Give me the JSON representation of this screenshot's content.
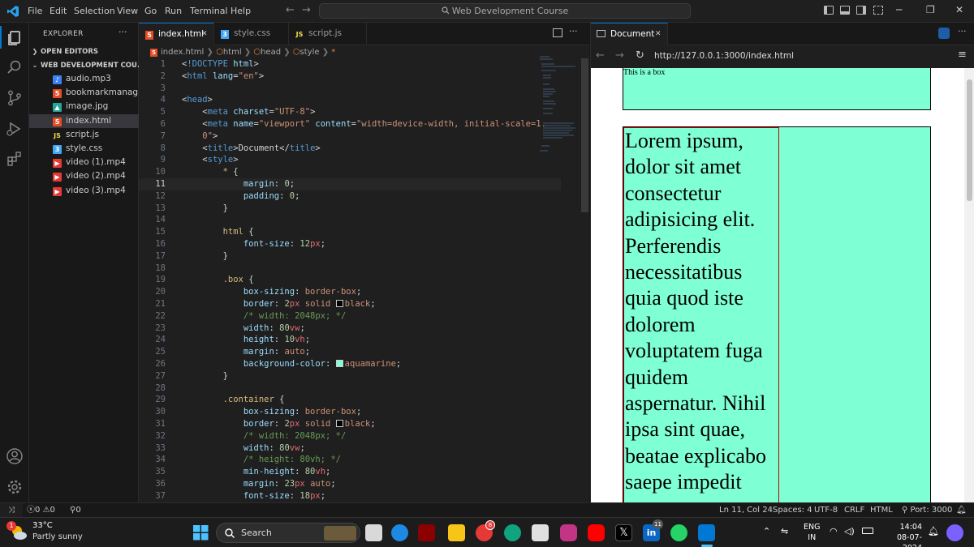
{
  "titlebar": {
    "menu": [
      "File",
      "Edit",
      "Selection",
      "View",
      "Go",
      "Run",
      "Terminal",
      "Help"
    ],
    "command_center": "Web Development Course",
    "nav_back": "←",
    "nav_forward": "→"
  },
  "sidebar": {
    "title": "EXPLORER",
    "more": "···",
    "open_editors": "OPEN EDITORS",
    "project": "WEB DEVELOPMENT COU...",
    "files": [
      {
        "name": "audio.mp3",
        "icon": "audio-file-icon",
        "color": "#3b82f6"
      },
      {
        "name": "bookmarkmanag...",
        "icon": "html-file-icon",
        "color": "#e44d26"
      },
      {
        "name": "image.jpg",
        "icon": "image-file-icon",
        "color": "#26a69a"
      },
      {
        "name": "index.html",
        "icon": "html-file-icon",
        "color": "#e44d26"
      },
      {
        "name": "script.js",
        "icon": "js-file-icon",
        "color": "#f0db4f"
      },
      {
        "name": "style.css",
        "icon": "css-file-icon",
        "color": "#42a5f5"
      },
      {
        "name": "video (1).mp4",
        "icon": "video-file-icon",
        "color": "#e53935"
      },
      {
        "name": "video (2).mp4",
        "icon": "video-file-icon",
        "color": "#e53935"
      },
      {
        "name": "video (3).mp4",
        "icon": "video-file-icon",
        "color": "#e53935"
      }
    ]
  },
  "editor": {
    "tabs": [
      {
        "label": "index.html",
        "icon": "html-file-icon",
        "close": "✕"
      },
      {
        "label": "style.css",
        "icon": "css-file-icon"
      },
      {
        "label": "script.js",
        "icon": "js-file-icon"
      }
    ],
    "breadcrumb": [
      "index.html",
      "html",
      "head",
      "style",
      "*"
    ],
    "current_line": 11,
    "lines": [
      [
        [
          "t-pun",
          "<"
        ],
        [
          "t-tag",
          "!DOCTYPE"
        ],
        [
          "t-attr",
          " html"
        ],
        [
          "t-pun",
          ">"
        ]
      ],
      [
        [
          "t-pun",
          "<"
        ],
        [
          "t-tag",
          "html"
        ],
        [
          "t-attr",
          " lang"
        ],
        [
          "t-pun",
          "="
        ],
        [
          "t-str",
          "\"en\""
        ],
        [
          "t-pun",
          ">"
        ]
      ],
      [],
      [
        [
          "t-pun",
          "<"
        ],
        [
          "t-tag",
          "head"
        ],
        [
          "t-pun",
          ">"
        ]
      ],
      [
        [
          "t-txt",
          "    "
        ],
        [
          "t-pun",
          "<"
        ],
        [
          "t-tag",
          "meta"
        ],
        [
          "t-attr",
          " charset"
        ],
        [
          "t-pun",
          "="
        ],
        [
          "t-str",
          "\"UTF-8\""
        ],
        [
          "t-pun",
          ">"
        ]
      ],
      [
        [
          "t-txt",
          "    "
        ],
        [
          "t-pun",
          "<"
        ],
        [
          "t-tag",
          "meta"
        ],
        [
          "t-attr",
          " name"
        ],
        [
          "t-pun",
          "="
        ],
        [
          "t-str",
          "\"viewport\""
        ],
        [
          "t-attr",
          " content"
        ],
        [
          "t-pun",
          "="
        ],
        [
          "t-str",
          "\"width=device-width, initial-scale=1."
        ]
      ],
      [
        [
          "t-str",
          "    0\""
        ],
        [
          "t-pun",
          ">"
        ]
      ],
      [
        [
          "t-txt",
          "    "
        ],
        [
          "t-pun",
          "<"
        ],
        [
          "t-tag",
          "title"
        ],
        [
          "t-pun",
          ">"
        ],
        [
          "t-txt",
          "Document"
        ],
        [
          "t-pun",
          "</"
        ],
        [
          "t-tag",
          "title"
        ],
        [
          "t-pun",
          ">"
        ]
      ],
      [
        [
          "t-txt",
          "    "
        ],
        [
          "t-pun",
          "<"
        ],
        [
          "t-tag",
          "style"
        ],
        [
          "t-pun",
          ">"
        ]
      ],
      [
        [
          "t-txt",
          "        "
        ],
        [
          "t-sel",
          "* "
        ],
        [
          "t-pun",
          "{"
        ]
      ],
      [
        [
          "t-txt",
          "            "
        ],
        [
          "t-prop",
          "margin"
        ],
        [
          "t-pun",
          ": "
        ],
        [
          "t-num",
          "0"
        ],
        [
          "t-pun",
          ";"
        ]
      ],
      [
        [
          "t-txt",
          "            "
        ],
        [
          "t-prop",
          "padding"
        ],
        [
          "t-pun",
          ": "
        ],
        [
          "t-num",
          "0"
        ],
        [
          "t-pun",
          ";"
        ]
      ],
      [
        [
          "t-txt",
          "        "
        ],
        [
          "t-pun",
          "}"
        ]
      ],
      [],
      [
        [
          "t-txt",
          "        "
        ],
        [
          "t-sel",
          "html "
        ],
        [
          "t-pun",
          "{"
        ]
      ],
      [
        [
          "t-txt",
          "            "
        ],
        [
          "t-prop",
          "font-size"
        ],
        [
          "t-pun",
          ": "
        ],
        [
          "t-num",
          "12"
        ],
        [
          "t-unit",
          "px"
        ],
        [
          "t-pun",
          ";"
        ]
      ],
      [
        [
          "t-txt",
          "        "
        ],
        [
          "t-pun",
          "}"
        ]
      ],
      [],
      [
        [
          "t-txt",
          "        "
        ],
        [
          "t-sel",
          ".box "
        ],
        [
          "t-pun",
          "{"
        ]
      ],
      [
        [
          "t-txt",
          "            "
        ],
        [
          "t-prop",
          "box-sizing"
        ],
        [
          "t-pun",
          ": "
        ],
        [
          "t-val",
          "border-box"
        ],
        [
          "t-pun",
          ";"
        ]
      ],
      [
        [
          "t-txt",
          "            "
        ],
        [
          "t-prop",
          "border"
        ],
        [
          "t-pun",
          ": "
        ],
        [
          "t-num",
          "2"
        ],
        [
          "t-unit",
          "px"
        ],
        [
          "t-val",
          " solid "
        ],
        [
          "swatch:#000000",
          ""
        ],
        [
          "t-val",
          "black"
        ],
        [
          "t-pun",
          ";"
        ]
      ],
      [
        [
          "t-txt",
          "            "
        ],
        [
          "t-cmt",
          "/* width: 2048px; */"
        ]
      ],
      [
        [
          "t-txt",
          "            "
        ],
        [
          "t-prop",
          "width"
        ],
        [
          "t-pun",
          ": "
        ],
        [
          "t-num",
          "80"
        ],
        [
          "t-unit",
          "vw"
        ],
        [
          "t-pun",
          ";"
        ]
      ],
      [
        [
          "t-txt",
          "            "
        ],
        [
          "t-prop",
          "height"
        ],
        [
          "t-pun",
          ": "
        ],
        [
          "t-num",
          "10"
        ],
        [
          "t-unit",
          "vh"
        ],
        [
          "t-pun",
          ";"
        ]
      ],
      [
        [
          "t-txt",
          "            "
        ],
        [
          "t-prop",
          "margin"
        ],
        [
          "t-pun",
          ": "
        ],
        [
          "t-val",
          "auto"
        ],
        [
          "t-pun",
          ";"
        ]
      ],
      [
        [
          "t-txt",
          "            "
        ],
        [
          "t-prop",
          "background-color"
        ],
        [
          "t-pun",
          ": "
        ],
        [
          "swatch:#7fffd4",
          ""
        ],
        [
          "t-val",
          "aquamarine"
        ],
        [
          "t-pun",
          ";"
        ]
      ],
      [
        [
          "t-txt",
          "        "
        ],
        [
          "t-pun",
          "}"
        ]
      ],
      [],
      [
        [
          "t-txt",
          "        "
        ],
        [
          "t-sel",
          ".container "
        ],
        [
          "t-pun",
          "{"
        ]
      ],
      [
        [
          "t-txt",
          "            "
        ],
        [
          "t-prop",
          "box-sizing"
        ],
        [
          "t-pun",
          ": "
        ],
        [
          "t-val",
          "border-box"
        ],
        [
          "t-pun",
          ";"
        ]
      ],
      [
        [
          "t-txt",
          "            "
        ],
        [
          "t-prop",
          "border"
        ],
        [
          "t-pun",
          ": "
        ],
        [
          "t-num",
          "2"
        ],
        [
          "t-unit",
          "px"
        ],
        [
          "t-val",
          " solid "
        ],
        [
          "swatch:#000000",
          ""
        ],
        [
          "t-val",
          "black"
        ],
        [
          "t-pun",
          ";"
        ]
      ],
      [
        [
          "t-txt",
          "            "
        ],
        [
          "t-cmt",
          "/* width: 2048px; */"
        ]
      ],
      [
        [
          "t-txt",
          "            "
        ],
        [
          "t-prop",
          "width"
        ],
        [
          "t-pun",
          ": "
        ],
        [
          "t-num",
          "80"
        ],
        [
          "t-unit",
          "vw"
        ],
        [
          "t-pun",
          ";"
        ]
      ],
      [
        [
          "t-txt",
          "            "
        ],
        [
          "t-cmt",
          "/* height: 80vh; */"
        ]
      ],
      [
        [
          "t-txt",
          "            "
        ],
        [
          "t-prop",
          "min-height"
        ],
        [
          "t-pun",
          ": "
        ],
        [
          "t-num",
          "80"
        ],
        [
          "t-unit",
          "vh"
        ],
        [
          "t-pun",
          ";"
        ]
      ],
      [
        [
          "t-txt",
          "            "
        ],
        [
          "t-prop",
          "margin"
        ],
        [
          "t-pun",
          ": "
        ],
        [
          "t-num",
          "23"
        ],
        [
          "t-unit",
          "px"
        ],
        [
          "t-val",
          " auto"
        ],
        [
          "t-pun",
          ";"
        ]
      ],
      [
        [
          "t-txt",
          "            "
        ],
        [
          "t-prop",
          "font-size"
        ],
        [
          "t-pun",
          ": "
        ],
        [
          "t-num",
          "18"
        ],
        [
          "t-unit",
          "px"
        ],
        [
          "t-pun",
          ";"
        ]
      ]
    ]
  },
  "browser": {
    "tab_label": "Document",
    "tab_close": "✕",
    "url": "http://127.0.0.1:3000/index.html",
    "box_text": "This is a box",
    "lorem": "Lorem ipsum, dolor sit amet consectetur adipisicing elit. Perferendis necessitatibus quia quod iste dolorem voluptatem fuga quidem aspernatur. Nihil ipsa sint quae, beatae explicabo saepe impedit"
  },
  "status": {
    "errors": "0",
    "warnings": "0",
    "ports": "0",
    "position": "Ln 11, Col 24",
    "spaces": "Spaces: 4",
    "encoding": "UTF-8",
    "eol": "CRLF",
    "language": "HTML",
    "port": "Port: 3000"
  },
  "taskbar": {
    "temp": "33°C",
    "weather": "Partly sunny",
    "weather_badge": "1",
    "search": "Search",
    "lang_top": "ENG",
    "lang_bottom": "IN",
    "time": "14:04",
    "date": "08-07-2024",
    "chrome_badge": "8",
    "linkedin_badge": "11"
  },
  "colors": {
    "accent": "#0078d4",
    "aquamarine": "#7fffd4"
  }
}
